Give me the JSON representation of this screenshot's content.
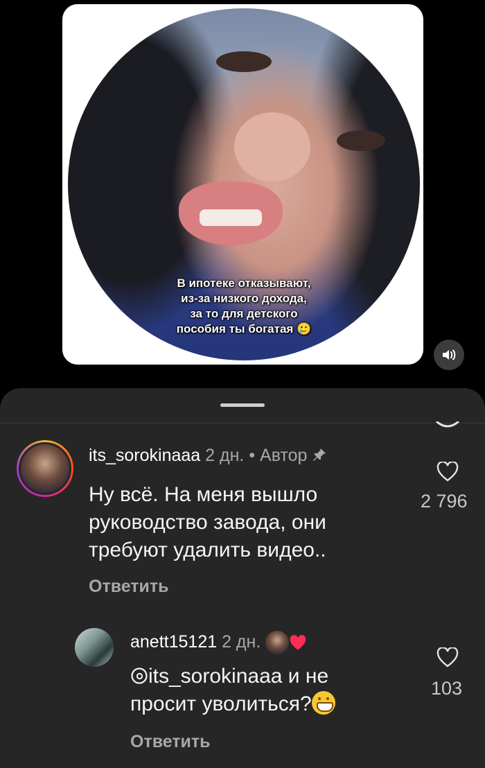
{
  "video": {
    "caption_lines": [
      "В ипотеке отказывают,",
      "из-за низкого дохода,",
      "за то для детского",
      "пособия ты богатая 🥲"
    ],
    "sound_icon": "speaker-icon"
  },
  "comments": [
    {
      "username": "its_sorokinaaa",
      "time": "2 дн.",
      "author_label": "• Автор",
      "pinned_icon": "pin-icon",
      "text_lines": [
        "Ну всё. На меня вышло",
        "руководство завода, они",
        "требуют удалить видео.."
      ],
      "reply_label": "Ответить",
      "like_count": "2 796"
    },
    {
      "username": "anett15121",
      "time": "2 дн.",
      "mention": "its_sorokinaaa",
      "text_line1_suffix": " и не",
      "text_line2": "просит уволиться?",
      "reply_label": "Ответить",
      "like_count": "103"
    }
  ],
  "colors": {
    "sheet_bg": "#262626",
    "secondary_text": "#a8a8a8",
    "heart_red": "#ff2d55"
  }
}
